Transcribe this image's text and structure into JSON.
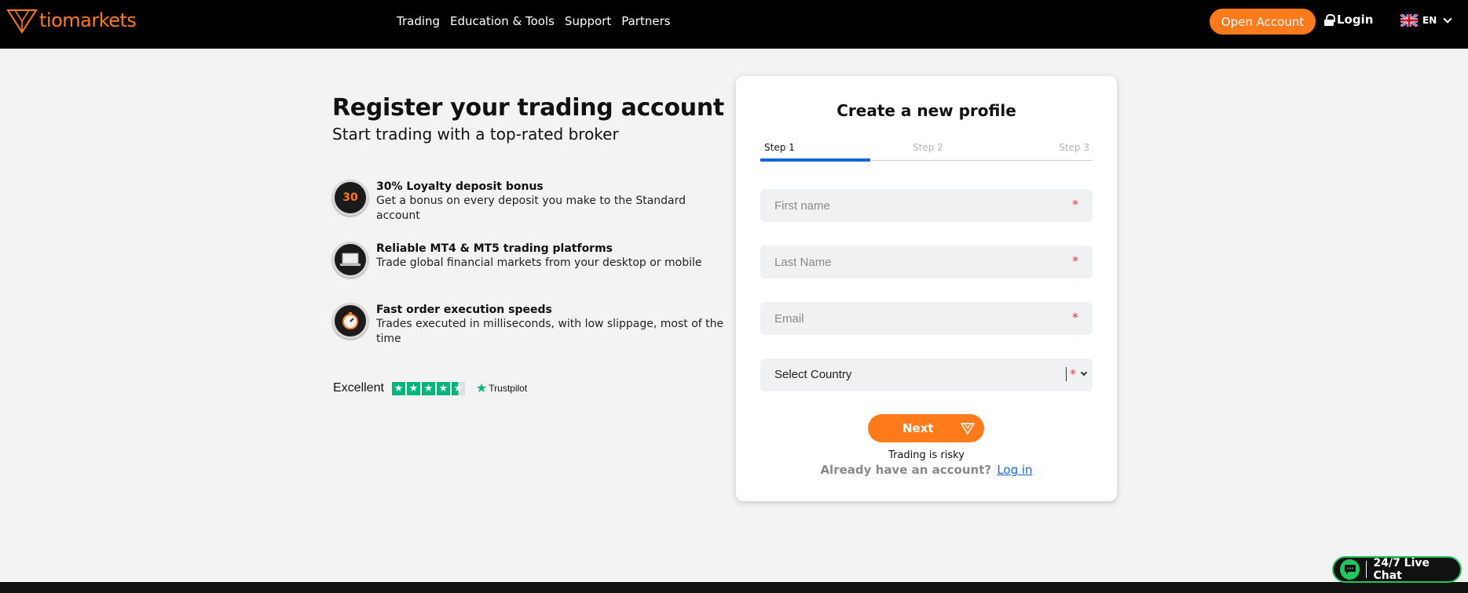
{
  "header": {
    "logo_text": "tiomarkets",
    "nav": [
      "Trading",
      "Education & Tools",
      "Support",
      "Partners"
    ],
    "open_account": "Open Account",
    "login": "Login",
    "language": "EN",
    "accent_color": "#ff7a1a"
  },
  "intro": {
    "title": "Register your trading account",
    "subtitle": "Start trading with a top-rated broker"
  },
  "features": [
    {
      "icon": "bonus-icon",
      "badge": "30",
      "title": "30% Loyalty deposit bonus",
      "desc": "Get a bonus on every deposit you make to the Standard account"
    },
    {
      "icon": "platform-icon",
      "title": "Reliable MT4 & MT5 trading platforms",
      "desc": "Trade global financial markets from your desktop or mobile"
    },
    {
      "icon": "stopwatch-icon",
      "title": "Fast order execution speeds",
      "desc": "Trades executed in milliseconds, with low slippage, most of the time"
    }
  ],
  "trustpilot": {
    "rating_text": "Excellent",
    "brand": "Trustpilot",
    "stars": 4.5
  },
  "form": {
    "title": "Create a new profile",
    "steps": [
      "Step 1",
      "Step 2",
      "Step 3"
    ],
    "active_step": 1,
    "first_name_placeholder": "First name",
    "last_name_placeholder": "Last Name",
    "email_placeholder": "Email",
    "country_value": "Select Country",
    "required_mark": "*",
    "next": "Next",
    "risk_notice": "Trading is risky",
    "already_text": "Already have an account?",
    "login_link": "Log in"
  },
  "chat": {
    "label": "24/7 Live Chat"
  }
}
